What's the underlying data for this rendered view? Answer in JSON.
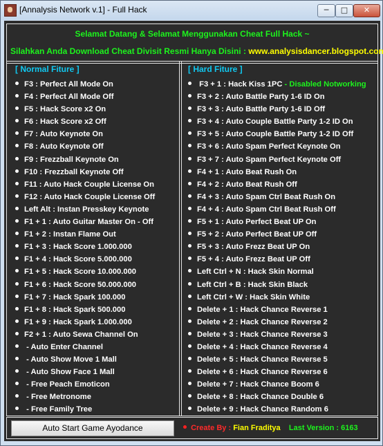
{
  "window": {
    "title": "[Annalysis Network v.1] - Full Hack",
    "min_symbol": "─",
    "max_symbol": "□",
    "close_symbol": "✕"
  },
  "banner": {
    "welcome": "Selamat Datang & Selamat Menggunakan Cheat Full Hack ~",
    "download_text": "Silahkan Anda Download Cheat Divisit Resmi Hanya Disini :",
    "download_site": "www.analysisdancer.blogspot.com"
  },
  "left_panel": {
    "title": "[ Normal Fiture ]",
    "items": [
      "F3 : Perfect All Mode On",
      "F4 : Perfect All Mode Off",
      "F5 : Hack Score x2 On",
      "F6 : Hack Score x2 Off",
      "F7 : Auto Keynote On",
      "F8 : Auto Keynote Off",
      "F9 : Frezzball Keynote On",
      "F10 : Frezzball Keynote Off",
      "F11 : Auto Hack Couple License On",
      "F12 : Auto Hack Couple License Off",
      "Left Alt : Instan Presskey Keynote",
      "F1 + 1 : Auto Guitar Master On - Off",
      "F1 + 2  : Instan Flame Out",
      "F1 + 3  : Hack Score  1.000.000",
      "F1 + 4  : Hack Score  5.000.000",
      "F1 + 5  : Hack Score  10.000.000",
      "F1 + 6  : Hack Score  50.000.000",
      "F1 + 7  : Hack Spark  100.000",
      "F1 + 8  : Hack Spark  500.000",
      "F1 + 9  : Hack Spark 1.000.000",
      "F2 + 1  : Auto Sewa Channel On",
      " - Auto Enter Channel",
      " - Auto Show Move 1 Mall",
      " - Auto Show Face 1 Mall",
      " - Free Peach Emoticon",
      " - Free Metronome",
      " - Free Family Tree"
    ]
  },
  "right_panel": {
    "title": "[ Hard Fiture ]",
    "first_item": "F3 + 1 : Hack Kiss 1PC",
    "first_item_note": "- Disabled Notworking",
    "items": [
      "F3 + 2 : Auto Battle Party 1-6 ID On",
      "F3 + 3 : Auto Battle Party 1-6 ID Off",
      "F3 + 4 : Auto Couple Battle Party 1-2 ID On",
      "F3 + 5 : Auto Couple Battle Party 1-2 ID Off",
      "F3 + 6 : Auto Spam Perfect Keynote On",
      "F3 + 7 : Auto Spam Perfect Keynote Off",
      "F4 + 1 : Auto Beat Rush On",
      "F4 + 2 : Auto Beat Rush Off",
      "F4 + 3 : Auto Spam Ctrl Beat Rush On",
      "F4 + 4 : Auto Spam Ctrl Beat Rush Off",
      "F5 + 1  : Auto Perfect Beat UP On",
      "F5 + 2  : Auto Perfect Beat UP Off",
      "F5 + 3  : Auto Frezz Beat UP On",
      "F5 + 4  : Auto Frezz Beat UP Off",
      "Left Ctrl + N  : Hack  Skin Normal",
      "Left Ctrl + B  : Hack  Skin Black",
      "Left Ctrl + W  : Hack  Skin White",
      "Delete + 1 : Hack Chance Reverse 1",
      "Delete + 2 : Hack Chance Reverse 2",
      "Delete + 3 : Hack Chance Reverse 3",
      "Delete + 4 : Hack Chance Reverse 4",
      "Delete + 5 : Hack Chance Reverse 5",
      "Delete + 6 : Hack Chance Reverse 6",
      "Delete + 7 : Hack Chance Boom 6",
      "Delete + 8 : Hack Chance Double 6",
      "Delete + 9 : Hack Chance Random 6"
    ]
  },
  "footer": {
    "start_button": "Auto Start Game Ayodance",
    "create_label": "Create By :",
    "author": "Fian Fraditya",
    "version_label": "Last Version : 6163"
  },
  "colors": {
    "background": "#2b2b2b",
    "heading": "#10c8f0",
    "accent_green": "#1df31d",
    "accent_yellow": "#ffff00",
    "accent_red": "#ff2a2a"
  }
}
